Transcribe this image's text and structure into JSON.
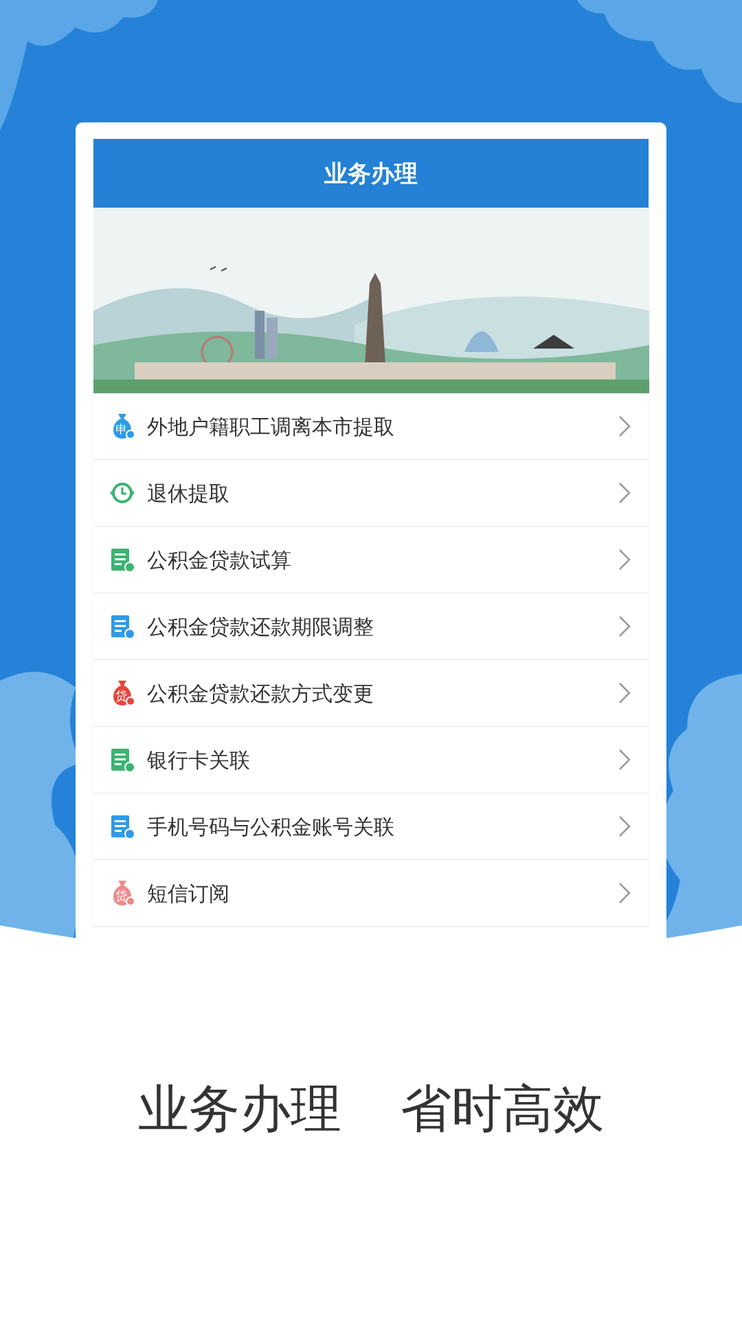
{
  "header": {
    "title": "业务办理"
  },
  "items": [
    {
      "label": "外地户籍职工调离本市提取",
      "icon": {
        "kind": "bag",
        "color": "#2f9be6",
        "badge": "申"
      }
    },
    {
      "label": "退休提取",
      "icon": {
        "kind": "clock",
        "color": "#3cb372"
      }
    },
    {
      "label": "公积金贷款试算",
      "icon": {
        "kind": "doc",
        "color": "#3cb372"
      }
    },
    {
      "label": "公积金贷款还款期限调整",
      "icon": {
        "kind": "doc",
        "color": "#2f9be6"
      }
    },
    {
      "label": "公积金贷款还款方式变更",
      "icon": {
        "kind": "bag",
        "color": "#e8453c",
        "badge": "贷"
      }
    },
    {
      "label": "银行卡关联",
      "icon": {
        "kind": "doc",
        "color": "#3cb372"
      }
    },
    {
      "label": "手机号码与公积金账号关联",
      "icon": {
        "kind": "doc",
        "color": "#2f9be6"
      }
    },
    {
      "label": "短信订阅",
      "icon": {
        "kind": "bag",
        "color": "#ef8a8a",
        "badge": "贷"
      }
    }
  ],
  "tagline": [
    "业务办理",
    "省时高效"
  ]
}
